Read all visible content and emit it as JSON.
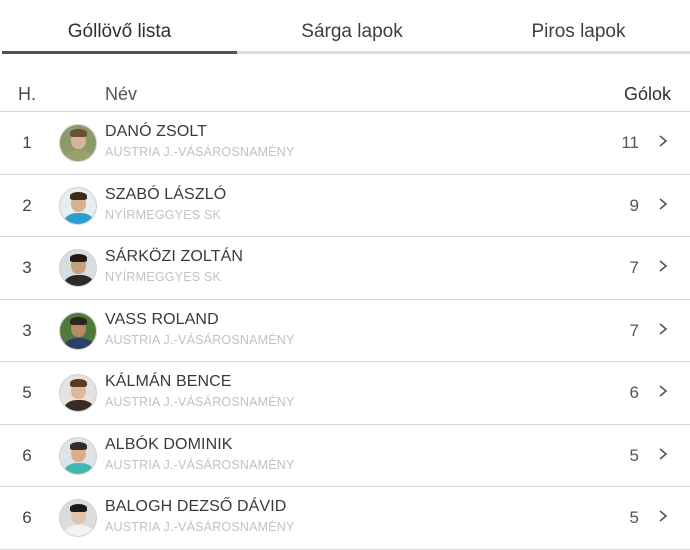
{
  "tabs": [
    {
      "label": "Góllövő lista",
      "active": true
    },
    {
      "label": "Sárga lapok",
      "active": false
    },
    {
      "label": "Piros lapok",
      "active": false
    }
  ],
  "table": {
    "headers": {
      "rank": "H.",
      "name": "Név",
      "goals": "Gólok"
    },
    "rows": [
      {
        "rank": "1",
        "name": "DANÓ ZSOLT",
        "team": "AUSTRIA J.-VÁSÁROSNAMÉNY",
        "goals": "11",
        "avatar": {
          "bg": "#8a9a6a",
          "skin": "#d6b59a",
          "hair": "#6b4f36",
          "shirt": "#9aa06a"
        }
      },
      {
        "rank": "2",
        "name": "SZABÓ LÁSZLÓ",
        "team": "NYÍRMEGGYES SK",
        "goals": "9",
        "avatar": {
          "bg": "#e6eef2",
          "skin": "#d8b08c",
          "hair": "#3a2a20",
          "shirt": "#2a9fd0"
        }
      },
      {
        "rank": "3",
        "name": "SÁRKÖZI ZOLTÁN",
        "team": "NYÍRMEGGYES SK",
        "goals": "7",
        "avatar": {
          "bg": "#d7dde0",
          "skin": "#c9a07c",
          "hair": "#1e1a18",
          "shirt": "#2b2b2b"
        }
      },
      {
        "rank": "3",
        "name": "VASS ROLAND",
        "team": "AUSTRIA J.-VÁSÁROSNAMÉNY",
        "goals": "7",
        "avatar": {
          "bg": "#4f7a3a",
          "skin": "#b98a66",
          "hair": "#2a2620",
          "shirt": "#2c3f6a"
        }
      },
      {
        "rank": "5",
        "name": "KÁLMÁN BENCE",
        "team": "AUSTRIA J.-VÁSÁROSNAMÉNY",
        "goals": "6",
        "avatar": {
          "bg": "#e3e3e0",
          "skin": "#e0b897",
          "hair": "#5a3c24",
          "shirt": "#3a2a24"
        }
      },
      {
        "rank": "6",
        "name": "ALBÓK DOMINIK",
        "team": "AUSTRIA J.-VÁSÁROSNAMÉNY",
        "goals": "5",
        "avatar": {
          "bg": "#dfe4e6",
          "skin": "#dcae8a",
          "hair": "#3a2c22",
          "shirt": "#3fb8b0"
        }
      },
      {
        "rank": "6",
        "name": "BALOGH DEZSŐ DÁVID",
        "team": "AUSTRIA J.-VÁSÁROSNAMÉNY",
        "goals": "5",
        "avatar": {
          "bg": "#dcdcdc",
          "skin": "#e2c4ac",
          "hair": "#1c1a1a",
          "shirt": "#f2f2f2"
        }
      }
    ]
  },
  "colors": {
    "active_tab_underline": "#5a4f58",
    "inactive_tab_underline": "#dcdcdc",
    "team_text": "#c2c2c2",
    "row_divider": "#d6d6d6"
  },
  "icons": {
    "row_action": "chevron-right-icon"
  }
}
